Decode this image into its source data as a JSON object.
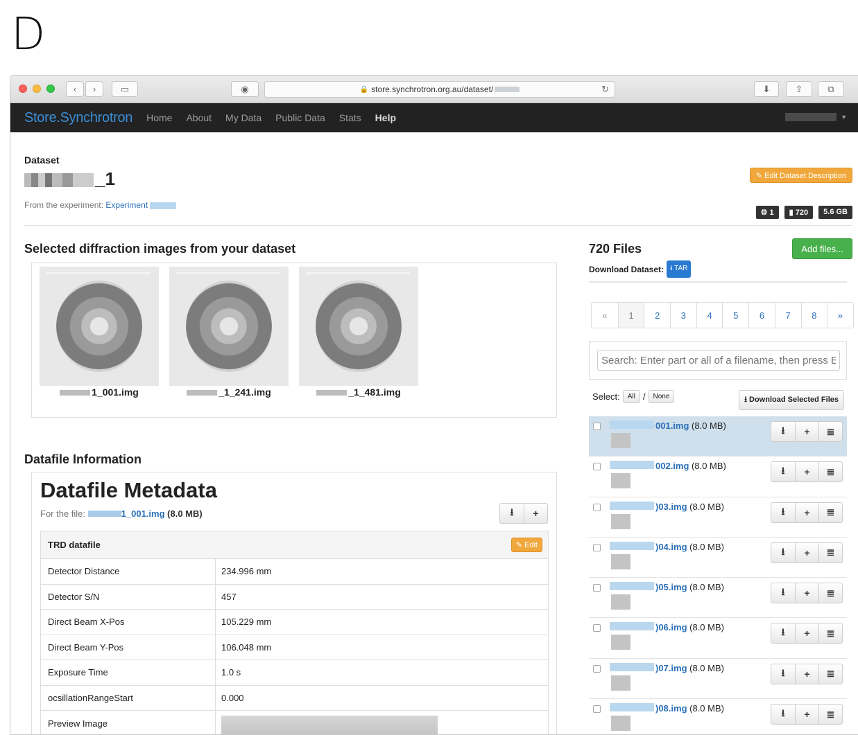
{
  "panel_letter": "D",
  "browser": {
    "url": "store.synchrotron.org.au/dataset/"
  },
  "navbar": {
    "brand": "Store.Synchrotron",
    "links": [
      "Home",
      "About",
      "My Data",
      "Public Data",
      "Stats",
      "Help"
    ]
  },
  "dataset": {
    "label": "Dataset",
    "title_suffix": "_1",
    "from_text": "From the experiment:",
    "experiment_link": "Experiment",
    "edit_button": "✎ Edit Dataset Description",
    "badges": [
      "⚙ 1",
      "▮ 720",
      "5.6 GB"
    ]
  },
  "images": {
    "heading": "Selected diffraction images from your dataset",
    "captions": [
      "1_001.img",
      "_1_241.img",
      "_1_481.img"
    ]
  },
  "datafile": {
    "heading": "Datafile Information",
    "meta_title": "Datafile Metadata",
    "for_file_label": "For the file:",
    "file_link": "1_001.img",
    "file_size": "(8.0 MB)",
    "table_title": "TRD datafile",
    "edit_label": "✎ Edit",
    "rows": [
      {
        "key": "Detector Distance",
        "value": "234.996 mm"
      },
      {
        "key": "Detector S/N",
        "value": "457"
      },
      {
        "key": "Direct Beam X-Pos",
        "value": "105.229 mm"
      },
      {
        "key": "Direct Beam Y-Pos",
        "value": "106.048 mm"
      },
      {
        "key": "Exposure Time",
        "value": "1.0 s"
      },
      {
        "key": "ocsillationRangeStart",
        "value": "0.000"
      },
      {
        "key": "Preview Image",
        "value": ""
      }
    ]
  },
  "files": {
    "heading": "720 Files",
    "download_label": "Download Dataset:",
    "tar_button": "⭳ TAR",
    "add_button": "Add files...",
    "pager": [
      "«",
      "1",
      "2",
      "3",
      "4",
      "5",
      "6",
      "7",
      "8",
      "»"
    ],
    "search_placeholder": "Search: Enter part or all of a filename, then press Enter",
    "select_label": "Select:",
    "select_all": "All",
    "select_sep": "/",
    "select_none": "None",
    "download_selected": "⭳ Download Selected Files",
    "list": [
      {
        "name": "001.img",
        "size": "(8.0 MB)"
      },
      {
        "name": "002.img",
        "size": "(8.0 MB)"
      },
      {
        "name": ")03.img",
        "size": "(8.0 MB)"
      },
      {
        "name": ")04.img",
        "size": "(8.0 MB)"
      },
      {
        "name": ")05.img",
        "size": "(8.0 MB)"
      },
      {
        "name": ")06.img",
        "size": "(8.0 MB)"
      },
      {
        "name": ")07.img",
        "size": "(8.0 MB)"
      },
      {
        "name": ")08.img",
        "size": "(8.0 MB)"
      }
    ]
  }
}
